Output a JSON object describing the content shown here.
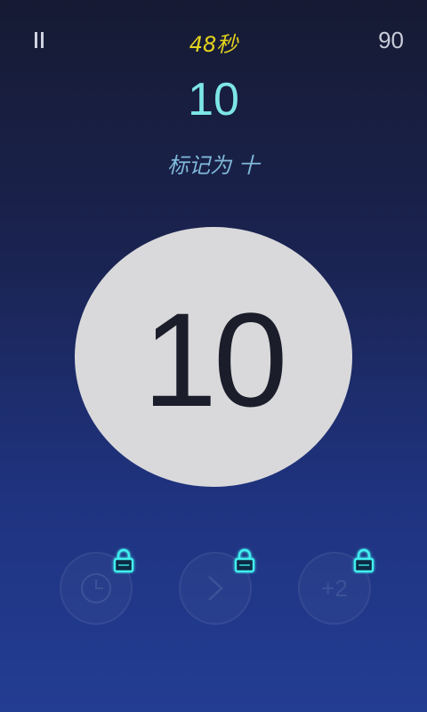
{
  "hud": {
    "timer": "48秒",
    "score": "90",
    "target_number": "10",
    "instruction": "标记为 十"
  },
  "circle": {
    "number": "10"
  },
  "powerups": [
    {
      "icon": "clock-icon",
      "locked": true
    },
    {
      "icon": "skip-arrow-icon",
      "locked": true
    },
    {
      "icon": "plus-two-icon",
      "label": "+2",
      "locked": true
    }
  ],
  "colors": {
    "timer": "#e2d21e",
    "target": "#7de6e6",
    "instruction": "#7fb8d8",
    "circle": "#d9d9db",
    "lock_glow": "#3ff0f0"
  }
}
